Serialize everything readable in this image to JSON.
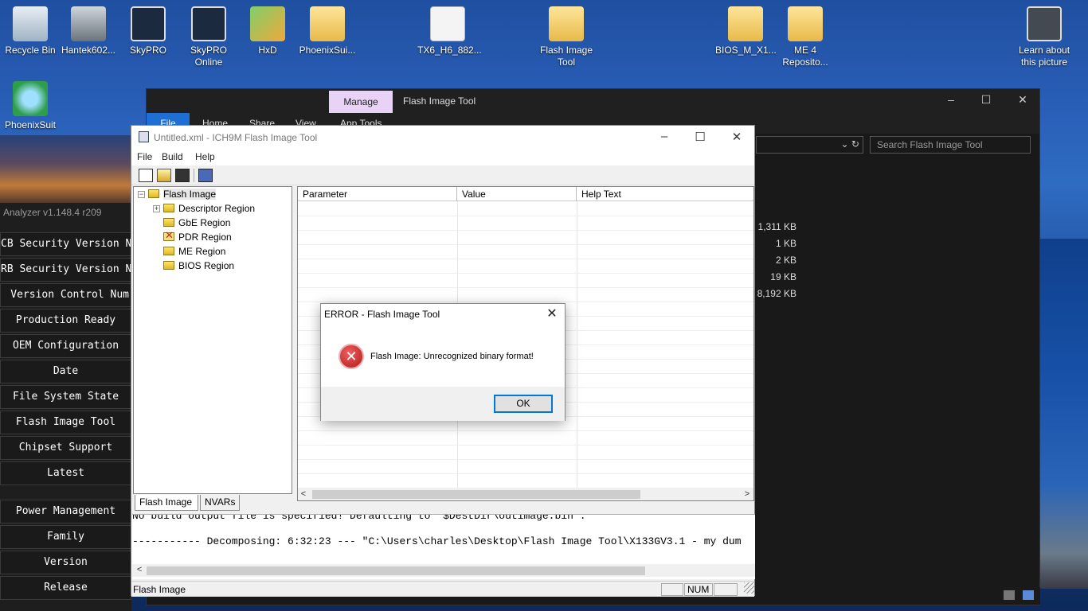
{
  "desktop": {
    "icons": [
      {
        "label": "Recycle Bin",
        "icon": "recycle-bin-icon"
      },
      {
        "label": "Hantek602...",
        "icon": "oscilloscope-icon"
      },
      {
        "label": "SkyPRO",
        "icon": "programmer-icon"
      },
      {
        "label": "SkyPRO Online",
        "icon": "programmer-online-icon"
      },
      {
        "label": "HxD",
        "icon": "hex-editor-icon"
      },
      {
        "label": "PhoenixSui...",
        "icon": "folder-icon"
      },
      {
        "label": "TX6_H6_882...",
        "icon": "disc-image-icon"
      },
      {
        "label": "Flash Image Tool",
        "icon": "folder-icon"
      },
      {
        "label": "BIOS_M_X1...",
        "icon": "folder-icon"
      },
      {
        "label": "ME 4 Reposito...",
        "icon": "folder-icon"
      },
      {
        "label": "Learn about this picture",
        "icon": "camera-icon"
      },
      {
        "label": "PhoenixSuit",
        "icon": "phoenix-suit-icon"
      }
    ]
  },
  "analyzer": {
    "title": "Analyzer v1.148.4 r209",
    "buttons": [
      "CB Security Version N",
      "RB Security Version N",
      "Version Control Num",
      "Production Ready",
      "OEM Configuration",
      "Date",
      "File System State",
      "Flash Image Tool",
      "Chipset Support",
      "Latest",
      "Power Management",
      "Family",
      "Version",
      "Release"
    ]
  },
  "explorer": {
    "manage_tab": "Manage",
    "title": "Flash Image Tool",
    "tabs": {
      "file": "File",
      "home": "Home",
      "share": "Share",
      "view": "View",
      "app_tools": "App Tools"
    },
    "search_placeholder": "Search Flash Image Tool",
    "sizes": [
      "1,311 KB",
      "1 KB",
      "2 KB",
      "19 KB",
      "8,192 KB"
    ]
  },
  "fit": {
    "title": "Untitled.xml - ICH9M Flash Image Tool",
    "menu": {
      "file": "File",
      "build": "Build",
      "help": "Help"
    },
    "tree": {
      "root": "Flash Image",
      "children": [
        "Descriptor Region",
        "GbE Region",
        "PDR Region",
        "ME Region",
        "BIOS Region"
      ]
    },
    "tree_tabs": {
      "flash_image": "Flash Image",
      "nvars": "NVARs"
    },
    "grid_columns": {
      "parameter": "Parameter",
      "value": "Value",
      "help_text": "Help Text"
    },
    "log_lines": [
      "No build output file is specified! Defaulting to \"$DestDir\\outimage.bin\".",
      "----------- Decomposing: 6:32:23 --- \"C:\\Users\\charles\\Desktop\\Flash Image Tool\\X133GV3.1 - my dum"
    ],
    "status": {
      "text": "Flash Image",
      "num": "NUM"
    }
  },
  "dialog": {
    "title": "ERROR - Flash Image Tool",
    "message": "Flash Image: Unrecognized binary format!",
    "ok_label": "OK"
  },
  "colors": {
    "accent": "#0078d7",
    "manage_tab": "#e8d3f6",
    "error_red": "#c42020"
  }
}
